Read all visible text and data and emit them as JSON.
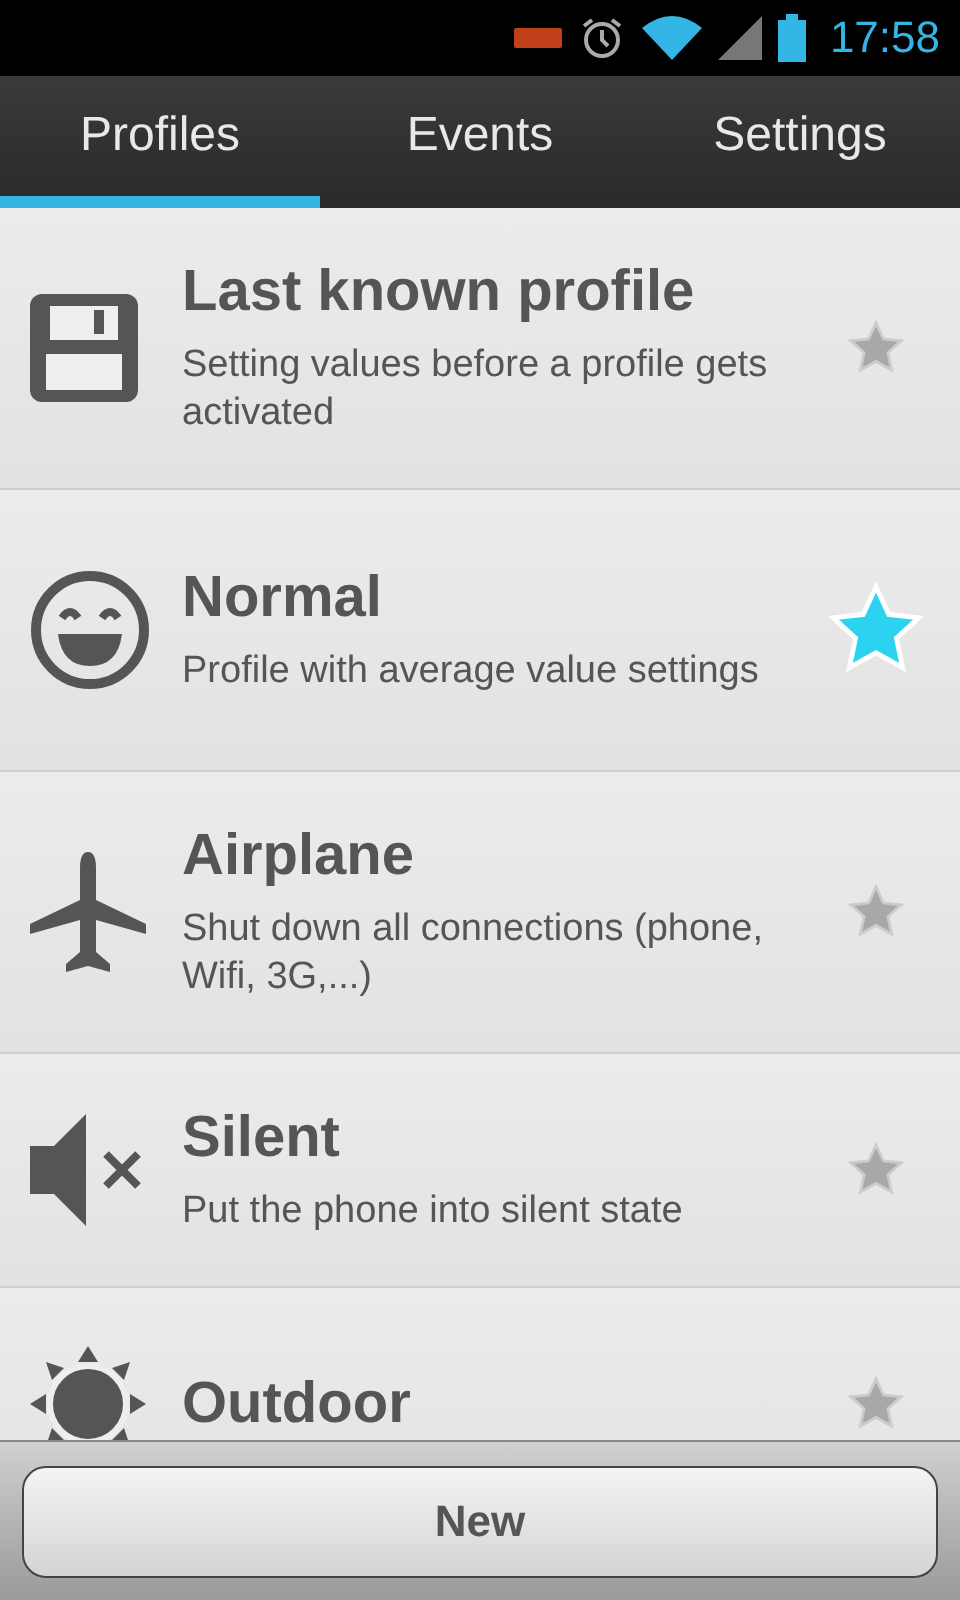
{
  "status_bar": {
    "time": "17:58"
  },
  "tabs": [
    {
      "label": "Profiles",
      "selected": true
    },
    {
      "label": "Events",
      "selected": false
    },
    {
      "label": "Settings",
      "selected": false
    }
  ],
  "profiles": [
    {
      "kind": "save",
      "name": "Last known profile",
      "description": "Setting values before a profile gets activated",
      "active": false
    },
    {
      "kind": "smiley",
      "name": "Normal",
      "description": "Profile with average value settings",
      "active": true
    },
    {
      "kind": "airplane",
      "name": "Airplane",
      "description": "Shut down all connections (phone, Wifi, 3G,...)",
      "active": false
    },
    {
      "kind": "mute",
      "name": "Silent",
      "description": "Put the phone into silent state",
      "active": false
    },
    {
      "kind": "sun",
      "name": "Outdoor",
      "active": false
    }
  ],
  "new_button": "New"
}
